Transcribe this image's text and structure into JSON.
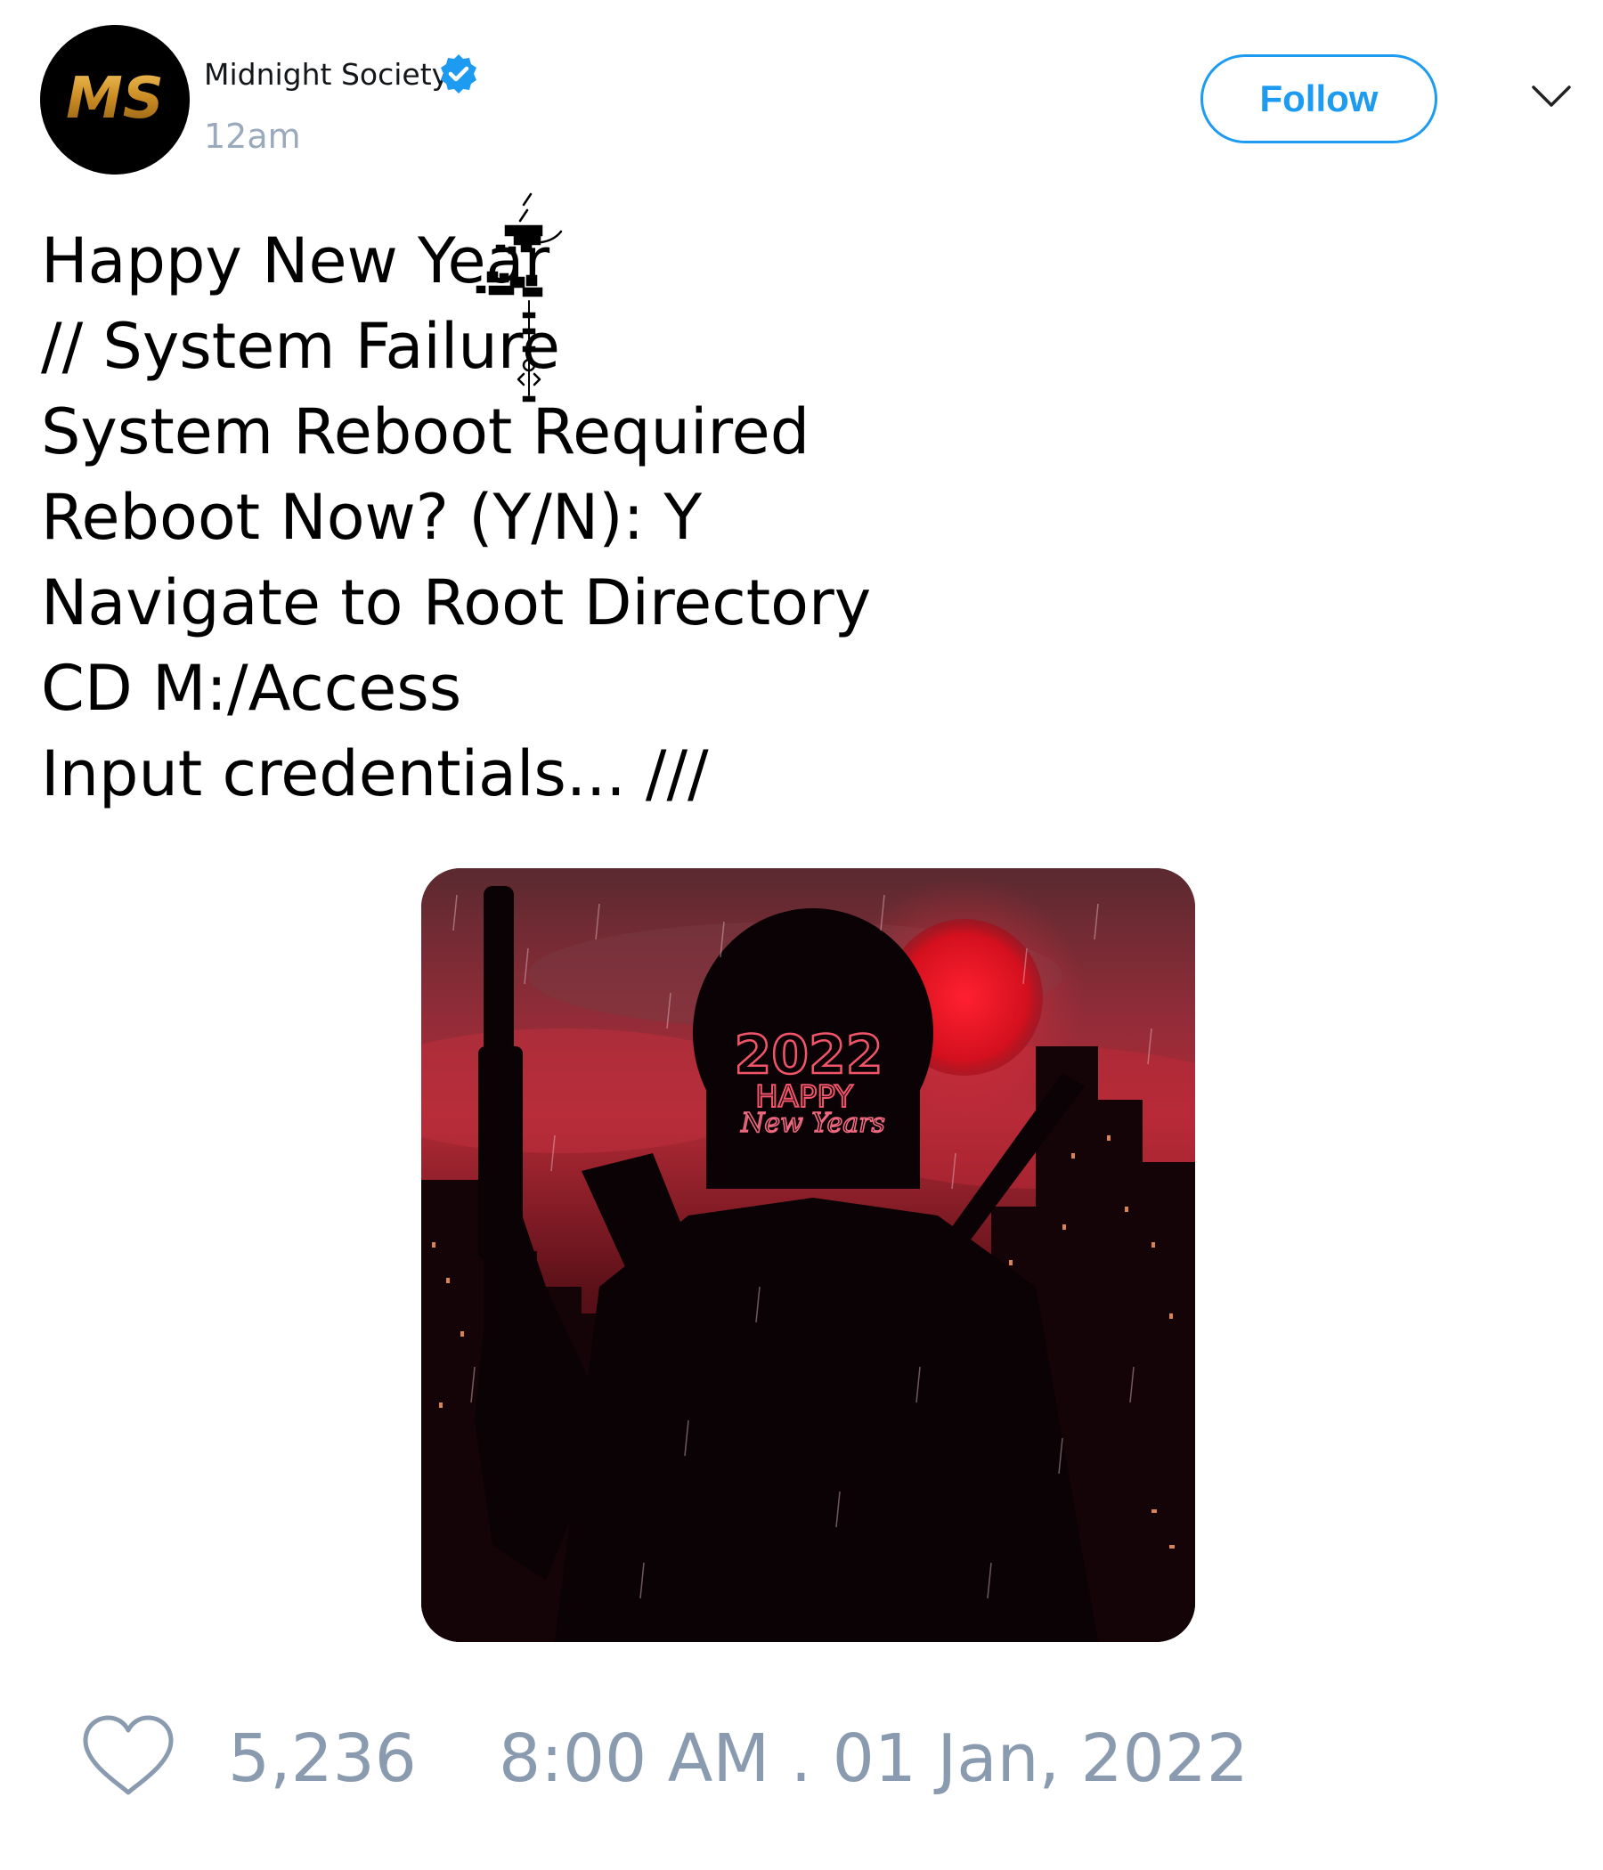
{
  "author": {
    "name": "Midnight Society",
    "time": "12am",
    "verified": true,
    "avatar_initials": "MS",
    "avatar_icon": "ms-logo-icon"
  },
  "header": {
    "follow_label": "Follow",
    "menu_icon": "chevron-down-icon"
  },
  "tweet": {
    "lines": [
      "Happy New Year",
      "// System Failure",
      "System Reboot Required",
      "Reboot Now? (Y/N): Y",
      "Navigate to Root Directory",
      "CD M:/Access",
      "Input credentials... ///"
    ]
  },
  "media": {
    "image_text_year": "2022",
    "image_text_happy": "HAPPY",
    "image_text_new_years": "New Years"
  },
  "footer": {
    "like_count": "5,236",
    "datetime": "8:00 AM . 01 Jan, 2022",
    "heart_icon": "heart-icon"
  },
  "colors": {
    "accent": "#1d9bf0",
    "muted": "#8a9bb0",
    "avatar_gold": "#d9a13a"
  }
}
